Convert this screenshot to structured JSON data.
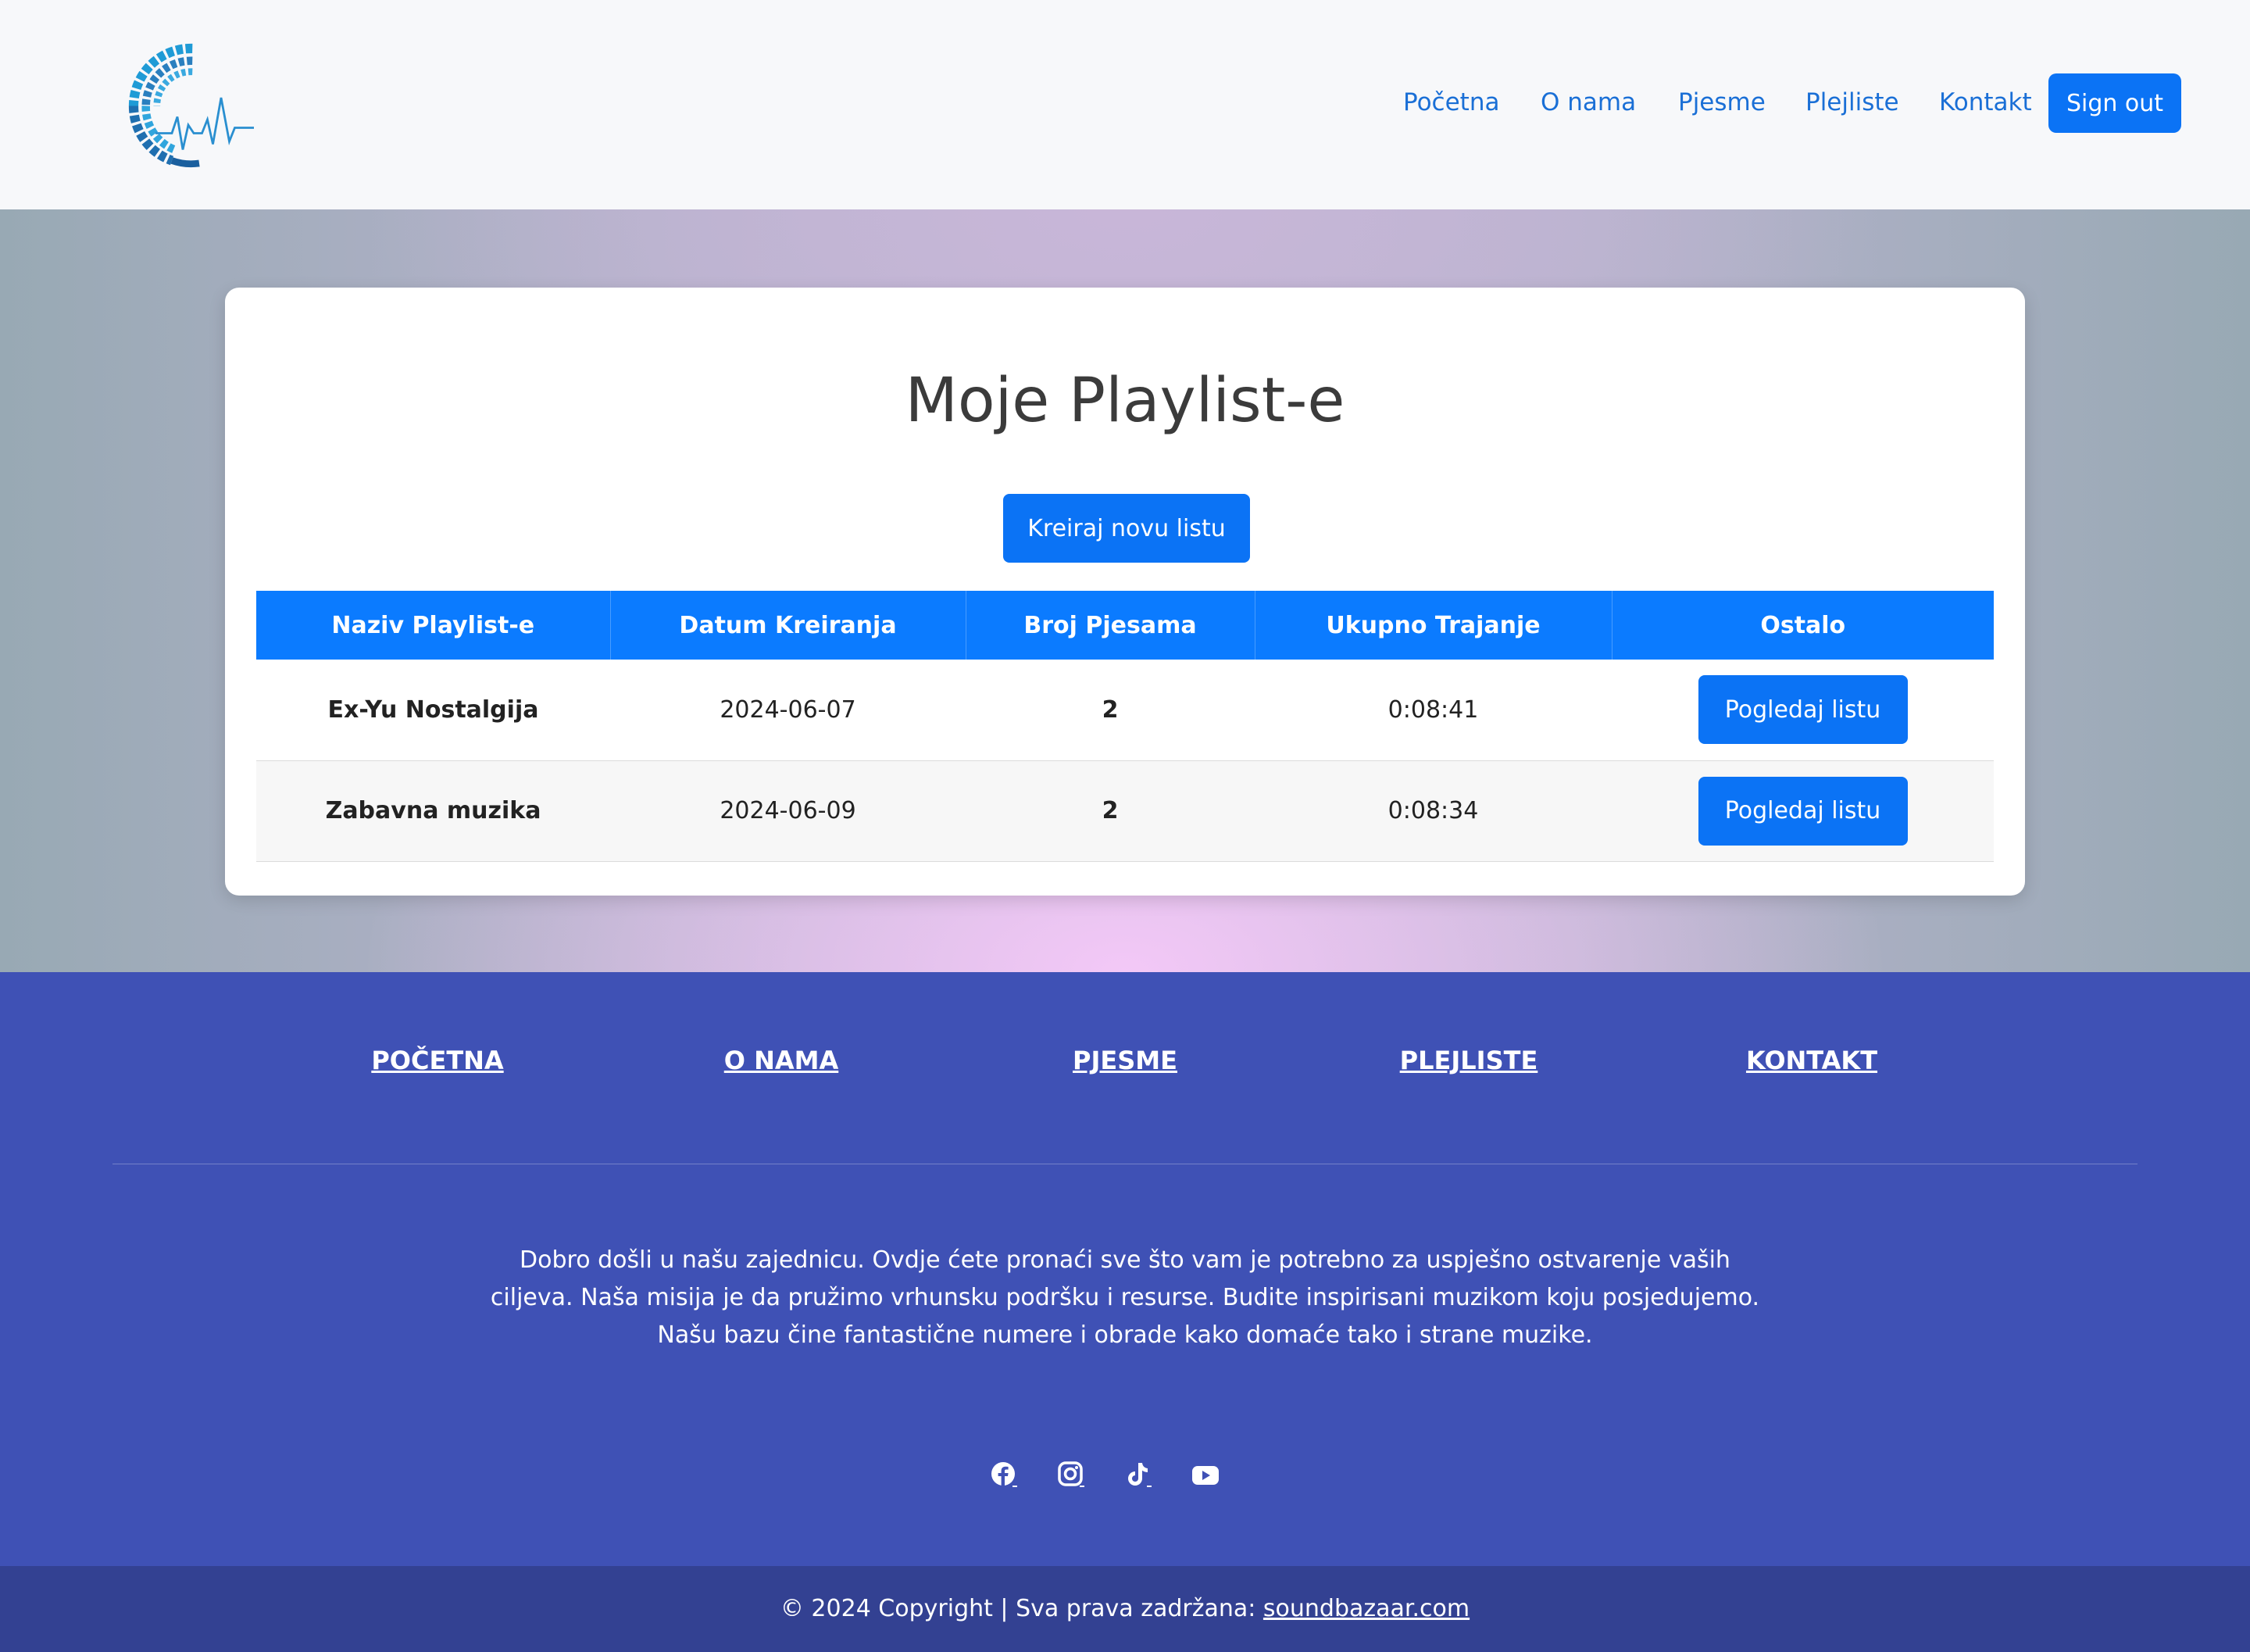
{
  "nav": {
    "links": [
      "Početna",
      "O nama",
      "Pjesme",
      "Plejliste",
      "Kontakt"
    ],
    "signout_label": "Sign out"
  },
  "main": {
    "title": "Moje Playlist-e",
    "create_button": "Kreiraj novu listu",
    "table": {
      "headers": [
        "Naziv Playlist-e",
        "Datum Kreiranja",
        "Broj Pjesama",
        "Ukupno Trajanje",
        "Ostalo"
      ],
      "rows": [
        {
          "name": "Ex-Yu Nostalgija",
          "date": "2024-06-07",
          "count": "2",
          "duration": "0:08:41",
          "action": "Pogledaj listu"
        },
        {
          "name": "Zabavna muzika",
          "date": "2024-06-09",
          "count": "2",
          "duration": "0:08:34",
          "action": "Pogledaj listu"
        }
      ]
    }
  },
  "footer": {
    "links": [
      "POČETNA",
      "O NAMA",
      "PJESME",
      "PLEJLISTE",
      "KONTAKT"
    ],
    "text": "Dobro došli u našu zajednicu. Ovdje ćete pronaći sve što vam je potrebno za uspješno ostvarenje vaših ciljeva. Naša misija je da pružimo vrhunsku podršku i resurse. Budite inspirisani muzikom koju posjedujemo. Našu bazu čine fantastične numere i obrade kako domaće tako i strane muzike.",
    "social": [
      "facebook-icon",
      "instagram-icon",
      "tiktok-icon",
      "youtube-icon"
    ],
    "copyright_prefix": "© 2024 Copyright | Sva prava zadržana: ",
    "copyright_link": "soundbazaar.com"
  },
  "colors": {
    "primary": "#0b73f5",
    "footer_bg": "#3f51b5",
    "copyright_bg": "#334192",
    "nav_link": "#1a6fd6"
  }
}
